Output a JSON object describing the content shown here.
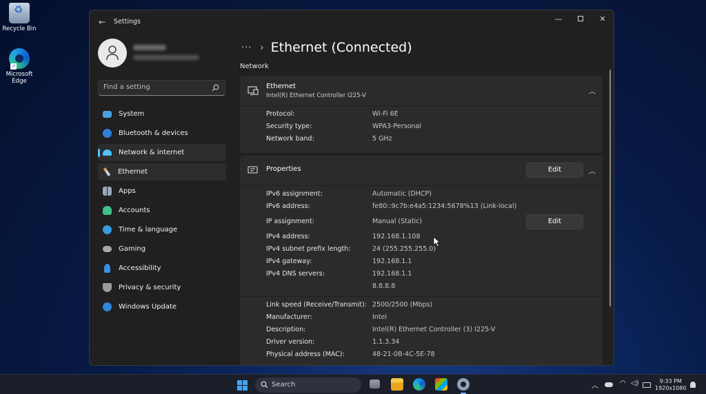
{
  "desktop": {
    "recycle_bin": "Recycle Bin",
    "edge_line1": "Microsoft",
    "edge_line2": "Edge"
  },
  "window": {
    "title": "Settings",
    "controls": {
      "minimize": "—",
      "close": "✕"
    }
  },
  "sidebar": {
    "search_placeholder": "Find a setting",
    "items": [
      {
        "label": "System",
        "icon": "monitor-icon",
        "color": "#4aa3df"
      },
      {
        "label": "Bluetooth & devices",
        "icon": "bluetooth-icon",
        "color": "#2f7fdc"
      },
      {
        "label": "Network & internet",
        "icon": "wifi-icon",
        "color": "#4cc2ff"
      },
      {
        "label": "Ethernet",
        "icon": "brush-icon",
        "color": "#e0a14a"
      },
      {
        "label": "Apps",
        "icon": "apps-icon",
        "color": "#9aa7b8"
      },
      {
        "label": "Accounts",
        "icon": "person-icon",
        "color": "#3fbf8a"
      },
      {
        "label": "Time & language",
        "icon": "globe-clock-icon",
        "color": "#3a9be0"
      },
      {
        "label": "Gaming",
        "icon": "gamepad-icon",
        "color": "#a8a8a8"
      },
      {
        "label": "Accessibility",
        "icon": "accessibility-icon",
        "color": "#3a8fe0"
      },
      {
        "label": "Privacy & security",
        "icon": "shield-icon",
        "color": "#9c9c9c"
      },
      {
        "label": "Windows Update",
        "icon": "update-icon",
        "color": "#2f86de"
      }
    ]
  },
  "main": {
    "breadcrumb_dots": "···",
    "breadcrumb_chevron": "›",
    "page_title": "Ethernet (Connected)",
    "section_label": "Network",
    "adapter_card": {
      "title": "Ethernet",
      "subtitle": "Intel(R) Ethernet Controller I225-V",
      "rows": [
        {
          "label": "Protocol:",
          "value": "Wi-Fi 6E"
        },
        {
          "label": "Security type:",
          "value": "WPA3-Personal"
        },
        {
          "label": "Network band:",
          "value": "5 GHz"
        }
      ]
    },
    "properties_card": {
      "title": "Properties",
      "edit_label": "Edit",
      "edit_ip_label": "Edit",
      "ipv6": [
        {
          "label": "IPv6 assignment:",
          "value": "Automatic (DHCP)"
        },
        {
          "label": "IPv6 address:",
          "value": "fe80::9c7b:e4a5:1234:5678%13 (Link-local)"
        }
      ],
      "ipv4": [
        {
          "label": "IP assignment:",
          "value": "Manual (Static)"
        },
        {
          "label": "IPv4 address:",
          "value": "192.168.1.108"
        },
        {
          "label": "IPv4 subnet prefix length:",
          "value": "24 (255.255.255.0)"
        },
        {
          "label": "IPv4 gateway:",
          "value": "192.168.1.1"
        },
        {
          "label": "IPv4 DNS servers:",
          "value": "192.168.1.1"
        },
        {
          "label": "",
          "value": "8.8.8.8"
        }
      ],
      "hardware": [
        {
          "label": "Link speed (Receive/Transmit):",
          "value": "2500/2500 (Mbps)"
        },
        {
          "label": "Manufacturer:",
          "value": "Intel"
        },
        {
          "label": "Description:",
          "value": "Intel(R) Ethernet Controller (3) I225-V"
        },
        {
          "label": "Driver version:",
          "value": "1.1.3.34"
        },
        {
          "label": "Physical address (MAC):",
          "value": "48-21-0B-4C-5E-78"
        }
      ]
    }
  },
  "taskbar": {
    "search_label": "Search",
    "time": "9:33 PM",
    "resolution": "1920x1080"
  }
}
